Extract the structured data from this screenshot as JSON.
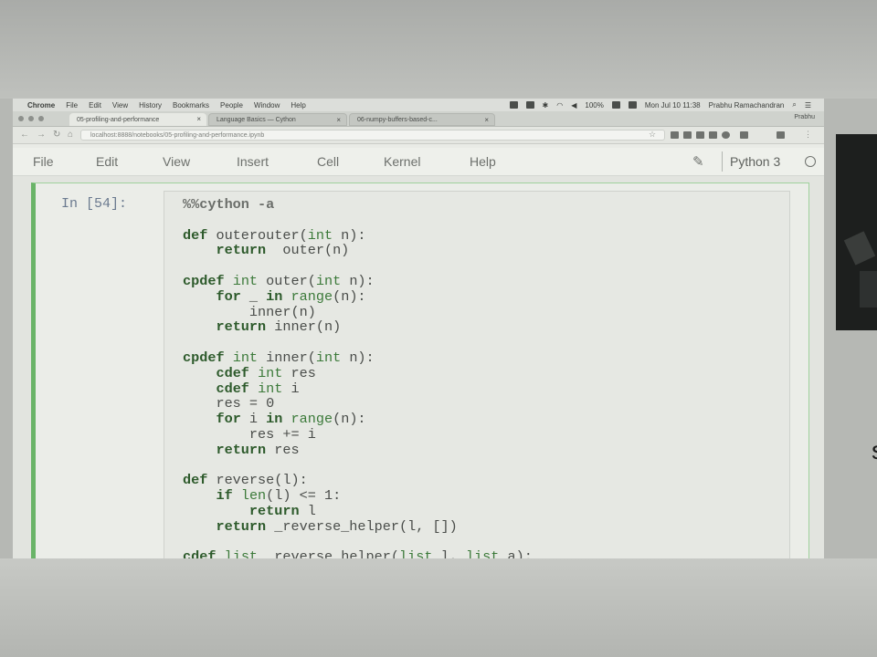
{
  "os_menubar": {
    "items": [
      "Chrome",
      "File",
      "Edit",
      "View",
      "History",
      "Bookmarks",
      "People",
      "Window",
      "Help"
    ],
    "battery": "100%",
    "clock": "Mon Jul 10 11:38",
    "user": "Prabhu Ramachandran"
  },
  "browser": {
    "tabs": [
      {
        "title": "05-profiling-and-performance",
        "active": true
      },
      {
        "title": "Language Basics — Cython",
        "active": false
      },
      {
        "title": "06-numpy-buffers-based-c...",
        "active": false
      }
    ],
    "profile": "Prabhu",
    "url": "localhost:8888/notebooks/05-profiling-and-performance.ipynb"
  },
  "jupyter": {
    "menu": [
      "File",
      "Edit",
      "View",
      "Insert",
      "Cell",
      "Kernel",
      "Help"
    ],
    "kernel_name": "Python 3"
  },
  "cell": {
    "prompt": "In [54]:",
    "code_lines": [
      "%%cython -a",
      "",
      "def outerouter(int n):",
      "    return  outer(n)",
      "",
      "cpdef int outer(int n):",
      "    for _ in range(n):",
      "        inner(n)",
      "    return inner(n)",
      "",
      "cpdef int inner(int n):",
      "    cdef int res",
      "    cdef int i",
      "    res = 0",
      "    for i in range(n):",
      "        res += i",
      "    return res",
      "",
      "def reverse(l):",
      "    if len(l) <= 1:",
      "        return l",
      "    return _reverse_helper(l, [])",
      "",
      "cdef list _reverse_helper(list l, list a):"
    ]
  },
  "colors": {
    "cell_border": "#6ab468",
    "keyword": "#2d5a2b",
    "builtin": "#3c7a3a"
  }
}
